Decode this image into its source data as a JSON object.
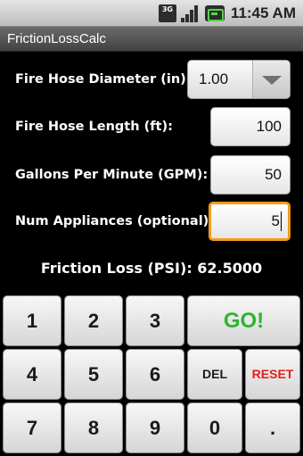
{
  "status_bar": {
    "network_type": "3G",
    "time": "11:45 AM",
    "icons": [
      "3g-icon",
      "signal-icon",
      "battery-icon"
    ]
  },
  "app": {
    "title": "FrictionLossCalc"
  },
  "form": {
    "diameter": {
      "label": "Fire Hose Diameter (in):",
      "value": "1.00"
    },
    "length": {
      "label": "Fire Hose Length (ft):",
      "value": "100"
    },
    "gpm": {
      "label": "Gallons Per Minute (GPM):",
      "value": "50"
    },
    "appliances": {
      "label": "Num Appliances (optional):",
      "value": "5"
    }
  },
  "result": {
    "text": "Friction Loss (PSI): 62.5000"
  },
  "keypad": {
    "k1": "1",
    "k2": "2",
    "k3": "3",
    "go": "GO!",
    "k4": "4",
    "k5": "5",
    "k6": "6",
    "del": "DEL",
    "reset": "RESET",
    "k7": "7",
    "k8": "8",
    "k9": "9",
    "k0": "0",
    "dot": "."
  },
  "colors": {
    "focus_border": "#f39a1e",
    "go_text": "#2db52d",
    "reset_text": "#e0201d",
    "background": "#000000"
  }
}
